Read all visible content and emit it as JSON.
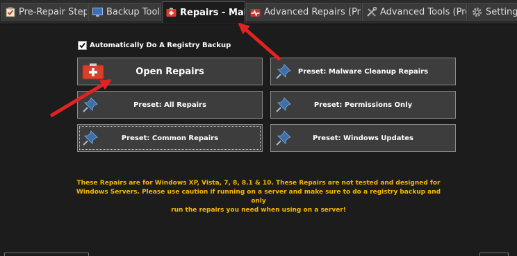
{
  "tabs": [
    {
      "label": "Pre-Repair Steps",
      "icon": "checklist-icon"
    },
    {
      "label": "Backup Tools",
      "icon": "monitor-icon"
    },
    {
      "label": "Repairs - Main",
      "icon": "first-aid-kit-icon",
      "active": true
    },
    {
      "label": "Advanced Repairs (Pro)",
      "icon": "heart-pulse-icon"
    },
    {
      "label": "Advanced Tools (Pro)",
      "icon": "tools-icon"
    },
    {
      "label": "Settings",
      "icon": "gear-icon"
    }
  ],
  "registry_backup": {
    "label": "Automatically Do A Registry Backup",
    "checked": true
  },
  "buttons": {
    "open_repairs": "Open Repairs",
    "all_repairs": "Preset: All Repairs",
    "common_repairs": "Preset: Common Repairs",
    "malware_cleanup": "Preset: Malware Cleanup Repairs",
    "permissions_only": "Preset: Permissions Only",
    "windows_updates": "Preset: Windows Updates"
  },
  "notice": {
    "line1": "These Repairs are for Windows XP, Vista, 7, 8, 8.1 & 10. These Repairs are not tested and designed for",
    "line2": "Windows Servers. Please use caution if running on a server and make sure to do a registry backup and only",
    "line3": "run the repairs you need when using on a server!"
  },
  "colors": {
    "background": "#1c1c1c",
    "notice": "#f5b800",
    "arrow": "#e32222",
    "kit": "#d9402b",
    "pin": "#3d6fa8"
  }
}
